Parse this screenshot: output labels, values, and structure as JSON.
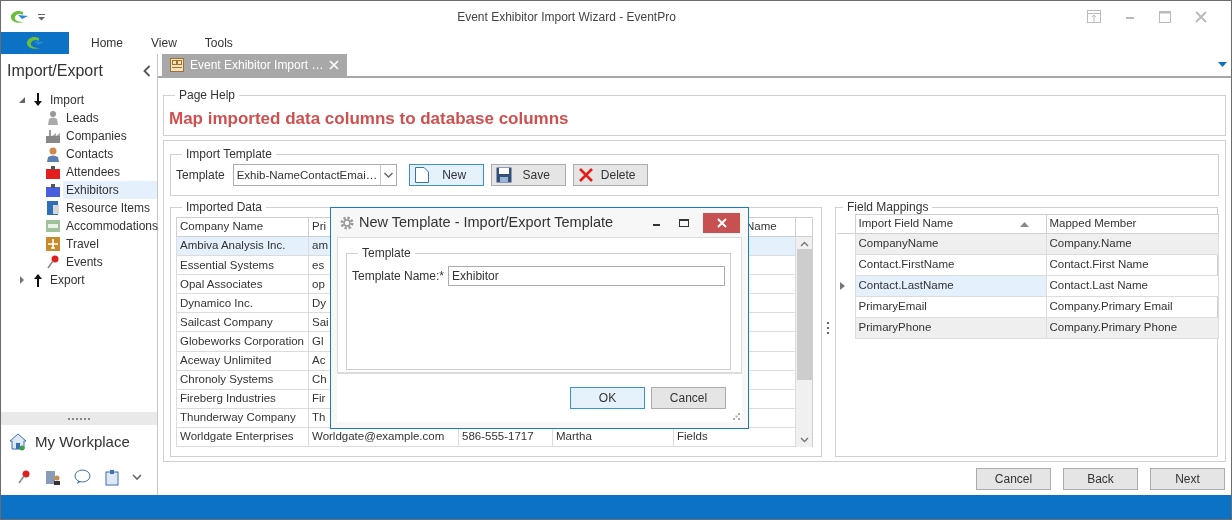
{
  "window": {
    "title": "Event Exhibitor Import Wizard - EventPro"
  },
  "ribbon": {
    "tabs": [
      {
        "label": "Home"
      },
      {
        "label": "View"
      },
      {
        "label": "Tools"
      }
    ]
  },
  "sidebar": {
    "title": "Import/Export",
    "tree": [
      {
        "label": "Import",
        "kind": "import",
        "expanded": true,
        "selected": false,
        "children": [
          {
            "label": "Leads",
            "selected": false
          },
          {
            "label": "Companies",
            "selected": false
          },
          {
            "label": "Contacts",
            "selected": false
          },
          {
            "label": "Attendees",
            "selected": false
          },
          {
            "label": "Exhibitors",
            "selected": true
          },
          {
            "label": "Resource Items",
            "selected": false
          },
          {
            "label": "Accommodations",
            "selected": false
          },
          {
            "label": "Travel",
            "selected": false
          },
          {
            "label": "Events",
            "selected": false
          }
        ]
      },
      {
        "label": "Export",
        "kind": "export",
        "expanded": false,
        "selected": false
      }
    ],
    "workplace": "My Workplace"
  },
  "document_tab": {
    "label": "Event Exhibitor Import …",
    "selected": true
  },
  "page_help": {
    "legend": "Page Help",
    "heading": "Map imported data columns to database columns"
  },
  "import_template": {
    "legend": "Import Template",
    "label": "Template",
    "value": "Exhib-NameContactEmai…",
    "buttons": [
      {
        "label": "New",
        "kind": "new",
        "focused": true
      },
      {
        "label": "Save",
        "kind": "save",
        "focused": false
      },
      {
        "label": "Delete",
        "kind": "delete",
        "focused": false
      }
    ]
  },
  "imported_data": {
    "legend": "Imported Data",
    "header": {
      "column_1": "Company Name",
      "column_2": "Pri",
      "column_5": "Name"
    },
    "rows": [
      {
        "column_1": "Ambiva Analysis Inc.",
        "column_2": "am",
        "selected": true
      },
      {
        "column_1": "Essential Systems",
        "column_2": "es",
        "selected": false
      },
      {
        "column_1": "Opal Associates",
        "column_2": "op",
        "selected": false
      },
      {
        "column_1": "Dynamico Inc.",
        "column_2": "Dy",
        "selected": false
      },
      {
        "column_1": "Sailcast Company",
        "column_2": "Sai",
        "selected": false
      },
      {
        "column_1": "Globeworks Corporation",
        "column_2": "Gl",
        "selected": false
      },
      {
        "column_1": "Aceway Unlimited",
        "column_2": "Ac",
        "selected": false
      },
      {
        "column_1": "Chronoly Systems",
        "column_2": "Ch",
        "selected": false
      },
      {
        "column_1": "Fireberg Industries",
        "column_2": "Fir",
        "selected": false
      },
      {
        "column_1": "Thunderway Company",
        "column_2": "Th",
        "selected": false
      },
      {
        "column_1": "Worldgate Enterprises",
        "column_2": "Worldgate@example.com",
        "column_3": "586-555-1717",
        "column_4": "Martha",
        "column_5": "Fields",
        "selected": false
      }
    ]
  },
  "field_mappings": {
    "legend": "Field Mappings",
    "columns": [
      {
        "label": "Import Field Name",
        "sorted": true
      },
      {
        "label": "Mapped Member",
        "sorted": false
      }
    ],
    "rows": [
      {
        "import_field": "CompanyName",
        "mapped_member": "Company.Name",
        "selected": false
      },
      {
        "import_field": "Contact.FirstName",
        "mapped_member": "Contact.First Name",
        "selected": false
      },
      {
        "import_field": "Contact.LastName",
        "mapped_member": "Contact.Last Name",
        "selected": true
      },
      {
        "import_field": "PrimaryEmail",
        "mapped_member": "Company.Primary Email",
        "selected": false
      },
      {
        "import_field": "PrimaryPhone",
        "mapped_member": "Company.Primary Phone",
        "selected": false
      }
    ]
  },
  "dialog": {
    "title": "New Template - Import/Export Template",
    "legend": "Template",
    "label": "Template Name:*",
    "value": "Exhibitor",
    "buttons": [
      {
        "label": "OK",
        "focused": true
      },
      {
        "label": "Cancel",
        "focused": false
      }
    ]
  },
  "footer_buttons": [
    {
      "label": "Cancel"
    },
    {
      "label": "Back"
    },
    {
      "label": "Next"
    }
  ]
}
